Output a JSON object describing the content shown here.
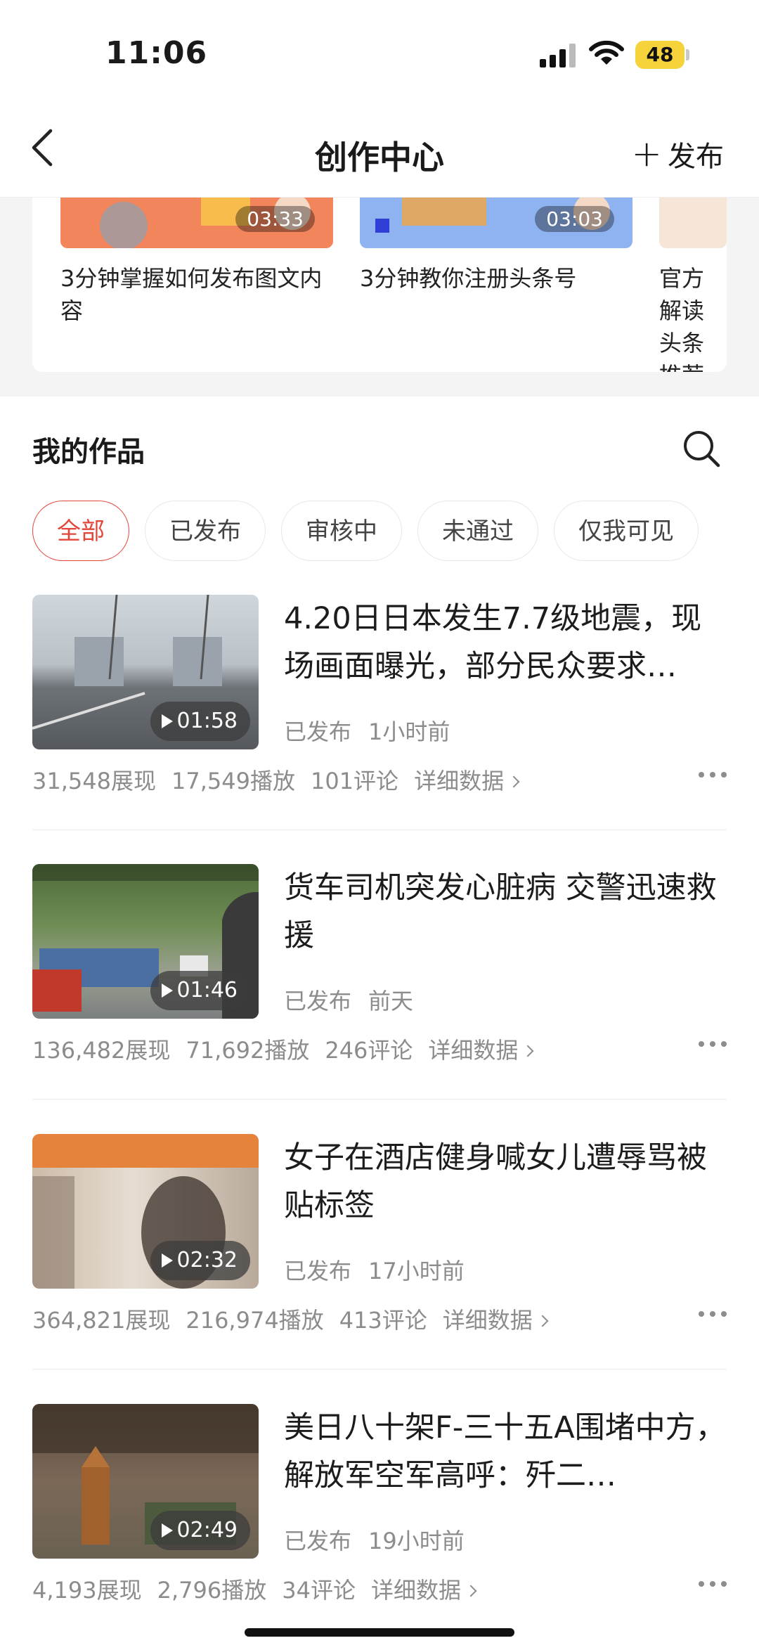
{
  "status_bar": {
    "time": "11:06",
    "battery": "48"
  },
  "nav": {
    "title": "创作中心",
    "publish_label": "发布"
  },
  "tutorials": [
    {
      "duration": "03:33",
      "title": "3分钟掌握如何发布图文内容",
      "color": "#f2855b"
    },
    {
      "duration": "03:03",
      "title": "3分钟教你注册头条号",
      "color": "#8fb3f0"
    },
    {
      "duration": "",
      "title": "官方解读头条推荐",
      "color": "#f5e6d8"
    }
  ],
  "works": {
    "heading": "我的作品",
    "filters": [
      "全部",
      "已发布",
      "审核中",
      "未通过",
      "仅我可见"
    ],
    "active_filter": "全部",
    "detail_label": "详细数据",
    "items": [
      {
        "title": "4.20日日本发生7.7级地震，现场画面曝光，部分民众要求…",
        "duration": "01:58",
        "status": "已发布",
        "time": "1小时前",
        "impressions": "31,548展现",
        "plays": "17,549播放",
        "comments": "101评论"
      },
      {
        "title": "货车司机突发心脏病 交警迅速救援",
        "duration": "01:46",
        "status": "已发布",
        "time": "前天",
        "impressions": "136,482展现",
        "plays": "71,692播放",
        "comments": "246评论"
      },
      {
        "title": "女子在酒店健身喊女儿遭辱骂被贴标签",
        "duration": "02:32",
        "status": "已发布",
        "time": "17小时前",
        "impressions": "364,821展现",
        "plays": "216,974播放",
        "comments": "413评论"
      },
      {
        "title": "美日八十架F-三十五A围堵中方，解放军空军高呼：歼二…",
        "duration": "02:49",
        "status": "已发布",
        "time": "19小时前",
        "impressions": "4,193展现",
        "plays": "2,796播放",
        "comments": "34评论"
      }
    ]
  },
  "colors": {
    "accent": "#e2473a",
    "muted": "#8c8c8c"
  }
}
